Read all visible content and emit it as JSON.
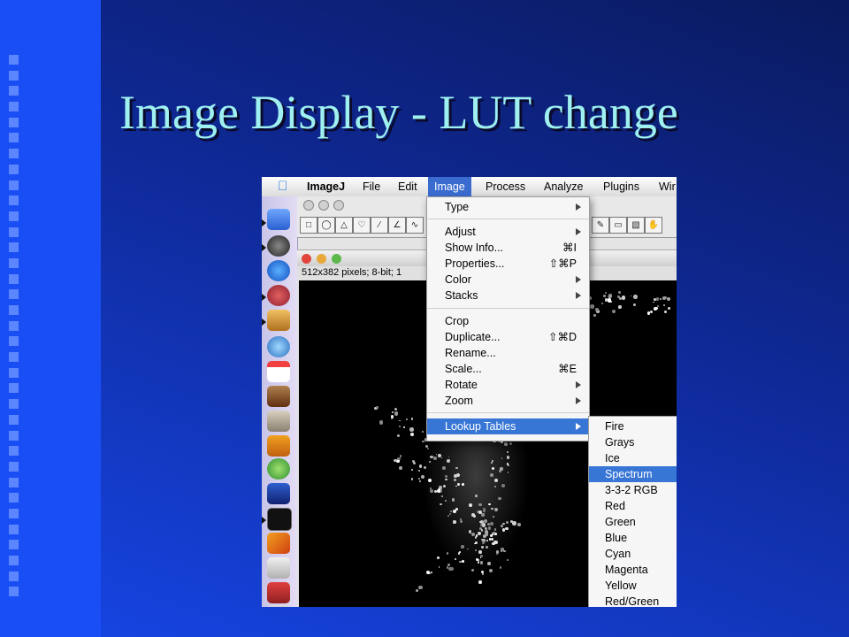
{
  "slide": {
    "title": "Image Display - LUT change"
  },
  "colors": {
    "accent": "#1a4ef5",
    "title": "#9ff0f0",
    "highlight": "#3876d6"
  },
  "menubar": {
    "apple_icon": "apple-icon",
    "items": [
      "ImageJ",
      "File",
      "Edit",
      "Image",
      "Process",
      "Analyze",
      "Plugins",
      "Wir"
    ]
  },
  "image_window": {
    "info": "512x382 pixels; 8-bit; 1"
  },
  "image_menu": {
    "items": [
      {
        "label": "Type",
        "shortcut": "",
        "submenu": true
      },
      {
        "label": "Adjust",
        "shortcut": "",
        "submenu": true
      },
      {
        "label": "Show Info...",
        "shortcut": "⌘I",
        "submenu": false
      },
      {
        "label": "Properties...",
        "shortcut": "⇧⌘P",
        "submenu": false
      },
      {
        "label": "Color",
        "shortcut": "",
        "submenu": true
      },
      {
        "label": "Stacks",
        "shortcut": "",
        "submenu": true
      },
      {
        "label": "Crop",
        "shortcut": "",
        "submenu": false
      },
      {
        "label": "Duplicate...",
        "shortcut": "⇧⌘D",
        "submenu": false
      },
      {
        "label": "Rename...",
        "shortcut": "",
        "submenu": false
      },
      {
        "label": "Scale...",
        "shortcut": "⌘E",
        "submenu": false
      },
      {
        "label": "Rotate",
        "shortcut": "",
        "submenu": true
      },
      {
        "label": "Zoom",
        "shortcut": "",
        "submenu": true
      },
      {
        "label": "Lookup Tables",
        "shortcut": "",
        "submenu": true
      }
    ],
    "selected": "Lookup Tables"
  },
  "lut_submenu": {
    "items": [
      "Fire",
      "Grays",
      "Ice",
      "Spectrum",
      "3-3-2 RGB",
      "Red",
      "Green",
      "Blue",
      "Cyan",
      "Magenta",
      "Yellow",
      "Red/Green"
    ],
    "selected": "Spectrum"
  }
}
